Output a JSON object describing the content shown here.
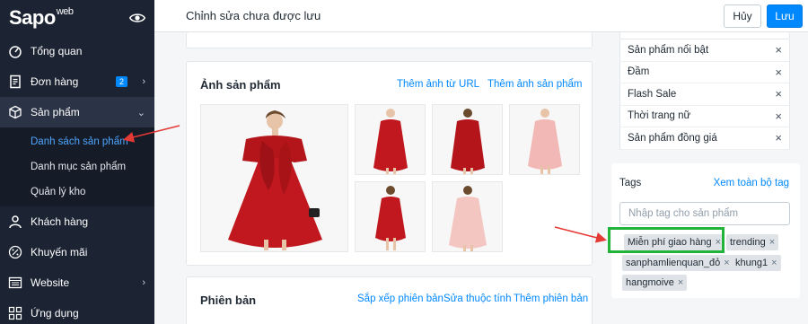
{
  "brand": {
    "logo": "Sapo",
    "logo_suffix": "web"
  },
  "sidebar": {
    "items": [
      {
        "label": "Tổng quan",
        "icon": "dashboard-icon"
      },
      {
        "label": "Đơn hàng",
        "icon": "orders-icon",
        "badge": "2"
      },
      {
        "label": "Sản phẩm",
        "icon": "box-icon",
        "expanded": true
      },
      {
        "label": "Khách hàng",
        "icon": "user-icon"
      },
      {
        "label": "Khuyến mãi",
        "icon": "percent-icon"
      },
      {
        "label": "Website",
        "icon": "browser-icon"
      },
      {
        "label": "Ứng dụng",
        "icon": "apps-icon"
      }
    ],
    "sub_items": [
      {
        "label": "Danh sách sản phẩm",
        "current": true
      },
      {
        "label": "Danh mục sản phẩm"
      },
      {
        "label": "Quản lý kho"
      }
    ]
  },
  "topbar": {
    "title": "Chỉnh sửa chưa được lưu",
    "cancel_label": "Hủy",
    "save_label": "Lưu"
  },
  "images_card": {
    "title": "Ảnh sản phẩm",
    "add_url_link": "Thêm ảnh từ URL",
    "add_image_link": "Thêm ảnh sản phẩm"
  },
  "variants_card": {
    "title": "Phiên bản",
    "sort_link": "Sắp xếp phiên bản",
    "edit_attr_link": "Sửa thuộc tính",
    "add_variant_link": "Thêm phiên bản"
  },
  "collections": [
    "Sản phẩm nổi bật",
    "Đầm",
    "Flash Sale",
    "Thời trang nữ",
    "Sản phẩm đồng giá"
  ],
  "tags_card": {
    "label": "Tags",
    "view_all": "Xem toàn bộ tag",
    "placeholder": "Nhập tag cho sản phẩm",
    "tags": [
      "Miễn phí giao hàng",
      "trending",
      "sanphamlienquan_đỏ",
      "khung1",
      "hangmoive"
    ]
  },
  "colors": {
    "sidebar": "#1c2433",
    "accent": "#0088ff",
    "highlight": "#22b33a",
    "annotation_arrow": "#e53935",
    "dress_red": "#c0181e",
    "dress_pink": "#f2b8b5"
  }
}
